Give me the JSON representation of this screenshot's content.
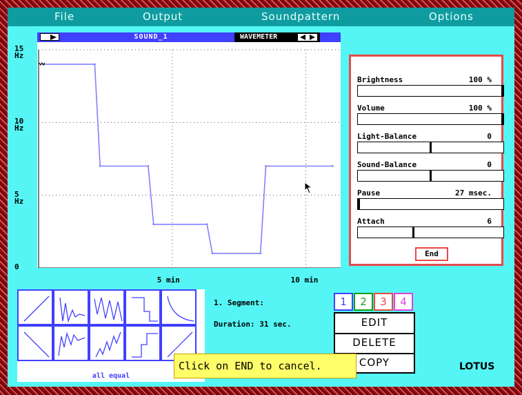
{
  "menu": {
    "file": "File",
    "output": "Output",
    "soundpattern": "Soundpattern",
    "options": "Options"
  },
  "graph": {
    "sound_name": "SOUND_1",
    "mode": "WAVEMETER"
  },
  "chart_data": {
    "type": "line",
    "title": "SOUND_1",
    "xlabel": "",
    "ylabel": "",
    "y_ticks": [
      {
        "value": 0,
        "label": "0"
      },
      {
        "value": 5,
        "label": "5",
        "unit": "Hz"
      },
      {
        "value": 10,
        "label": "10",
        "unit": "Hz"
      },
      {
        "value": 15,
        "label": "15",
        "unit": "Hz"
      }
    ],
    "x_ticks": [
      {
        "value": 5,
        "label": "5 min"
      },
      {
        "value": 10,
        "label": "10 min"
      }
    ],
    "xlim": [
      0,
      11.3
    ],
    "ylim": [
      0,
      15
    ],
    "grid": true,
    "x": [
      0.2,
      2.1,
      2.3,
      4.1,
      4.3,
      6.3,
      6.5,
      8.3,
      8.5,
      11.0
    ],
    "y": [
      14,
      14,
      7,
      7,
      3,
      3,
      1,
      1,
      7,
      7
    ]
  },
  "settings": [
    {
      "label": "Brightness",
      "value": "100 %",
      "level": 1.0
    },
    {
      "label": "Volume",
      "value": "100 %",
      "level": 1.0
    },
    {
      "label": "Light-Balance",
      "value": "0",
      "level": 0.5
    },
    {
      "label": "Sound-Balance",
      "value": "0",
      "level": 0.5
    },
    {
      "label": "Pause",
      "value": "27 msec.",
      "level": 0.0
    },
    {
      "label": "Attach",
      "value": "6",
      "level": 0.38
    }
  ],
  "end_label": "End",
  "shape_caption": "all equal",
  "segment_info": {
    "segment": "1. Segment:",
    "duration": "Duration: 31 sec."
  },
  "segment_buttons": [
    {
      "label": "1",
      "color": "#4040ff"
    },
    {
      "label": "2",
      "color": "#10a010"
    },
    {
      "label": "3",
      "color": "#e84848"
    },
    {
      "label": "4",
      "color": "#e040e0"
    }
  ],
  "actions": {
    "edit": "EDIT",
    "delete": "DELETE",
    "copy": "COPY"
  },
  "tooltip": "Click on END to cancel.",
  "brand": "LOTUS",
  "colors": {
    "background": "#55f5f5",
    "menubar": "#0f9ca0",
    "accent_blue": "#4040ff",
    "accent_red": "#e84848",
    "line": "#8080ff"
  }
}
